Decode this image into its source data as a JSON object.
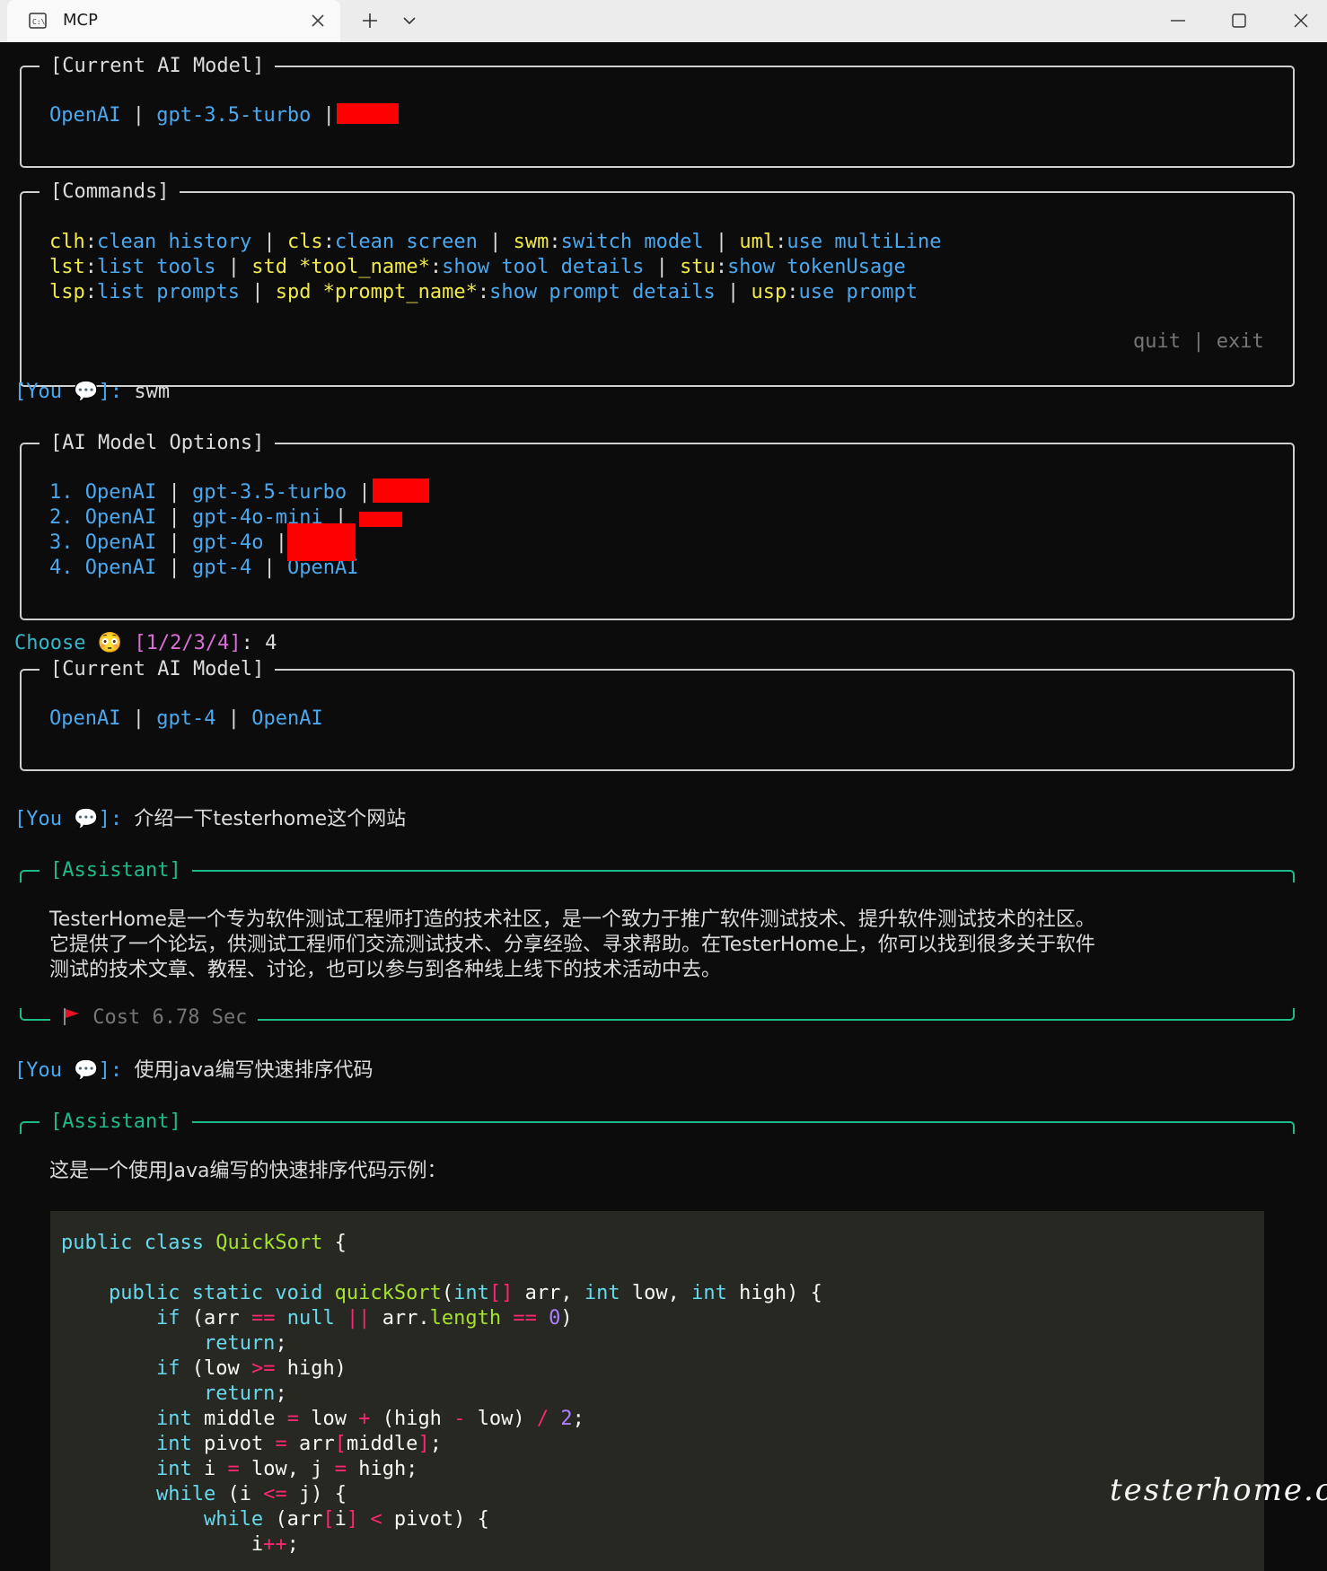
{
  "window": {
    "tab_title": "MCP",
    "new_tab": "+",
    "dropdown": "⌄"
  },
  "current_model_1": {
    "legend": "[Current AI Model]",
    "provider": "OpenAI",
    "sep": "|",
    "model": "gpt-3.5-turbo"
  },
  "commands": {
    "legend": "[Commands]",
    "row1": [
      {
        "key": "clh",
        "desc": "clean history"
      },
      {
        "key": "cls",
        "desc": "clean screen"
      },
      {
        "key": "swm",
        "desc": "switch model"
      },
      {
        "key": "uml",
        "desc": "use multiLine"
      }
    ],
    "row2": [
      {
        "key": "lst",
        "desc": "list tools"
      },
      {
        "key": "std *tool_name*",
        "desc": "show tool details"
      },
      {
        "key": "stu",
        "desc": "show tokenUsage"
      }
    ],
    "row3": [
      {
        "key": "lsp",
        "desc": "list prompts"
      },
      {
        "key": "spd *prompt_name*",
        "desc": "show prompt details"
      },
      {
        "key": "usp",
        "desc": "use prompt"
      }
    ],
    "footer_quit": "quit",
    "footer_sep": "|",
    "footer_exit": "exit"
  },
  "you_prompt": {
    "open": "[You",
    "close": "]:",
    "icon": "💬"
  },
  "msg1": "swm",
  "model_options": {
    "legend": "[AI Model Options]",
    "items": [
      {
        "num": "1.",
        "provider": "OpenAI",
        "model": "gpt-3.5-turbo",
        "base": ""
      },
      {
        "num": "2.",
        "provider": "OpenAI",
        "model": "gpt-4o-mini",
        "base": ""
      },
      {
        "num": "3.",
        "provider": "OpenAI",
        "model": "gpt-4o",
        "base": ""
      },
      {
        "num": "4.",
        "provider": "OpenAI",
        "model": "gpt-4",
        "base": "OpenAI"
      }
    ]
  },
  "choose": {
    "label": "Choose",
    "icon": "😳",
    "options": "[1/2/3/4]",
    "colon": ":",
    "answer": "4"
  },
  "current_model_2": {
    "legend": "[Current AI Model]",
    "provider": "OpenAI",
    "model": "gpt-4",
    "base": "OpenAI"
  },
  "msg2": "介绍一下testerhome这个网站",
  "assistant1": {
    "legend": "[Assistant]",
    "lines": [
      "TesterHome是一个专为软件测试工程师打造的技术社区，是一个致力于推广软件测试技术、提升软件测试技术的社区。",
      "它提供了一个论坛，供测试工程师们交流测试技术、分享经验、寻求帮助。在TesterHome上，你可以找到很多关于软件",
      "测试的技术文章、教程、讨论，也可以参与到各种线上线下的技术活动中去。"
    ],
    "cost": "Cost 6.78 Sec"
  },
  "msg3": "使用java编写快速排序代码",
  "assistant2": {
    "legend": "[Assistant]",
    "intro": "这是一个使用Java编写的快速排序代码示例："
  },
  "watermark": "testerhome.com"
}
